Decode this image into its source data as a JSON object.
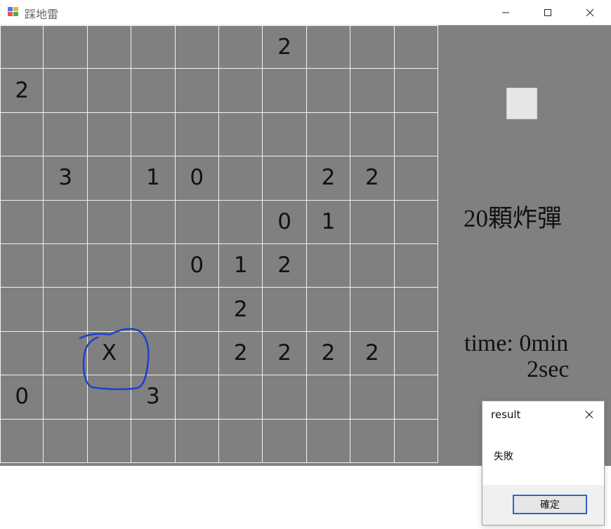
{
  "window": {
    "title": "踩地雷",
    "app_icon": "window-app-icon",
    "controls": {
      "minimize_icon": "minimize-icon",
      "maximize_icon": "maximize-icon",
      "close_icon": "close-icon"
    }
  },
  "board": {
    "rows": [
      [
        "",
        "",
        "",
        "",
        "",
        "",
        "2",
        "",
        "",
        ""
      ],
      [
        "2",
        "",
        "",
        "",
        "",
        "",
        "",
        "",
        "",
        ""
      ],
      [
        "",
        "",
        "",
        "",
        "",
        "",
        "",
        "",
        "",
        ""
      ],
      [
        "",
        "3",
        "",
        "1",
        "0",
        "",
        "",
        "2",
        "2",
        ""
      ],
      [
        "",
        "",
        "",
        "",
        "",
        "",
        "0",
        "1",
        "",
        ""
      ],
      [
        "",
        "",
        "",
        "",
        "0",
        "1",
        "2",
        "",
        "",
        ""
      ],
      [
        "",
        "",
        "",
        "",
        "",
        "2",
        "",
        "",
        "",
        ""
      ],
      [
        "",
        "",
        "X",
        "",
        "",
        "2",
        "2",
        "2",
        "2",
        ""
      ],
      [
        "0",
        "",
        "",
        "3",
        "",
        "",
        "",
        "",
        "",
        ""
      ],
      [
        "",
        "",
        "",
        "",
        "",
        "",
        "",
        "",
        "",
        ""
      ]
    ],
    "annotation_color": "#1f3fd1"
  },
  "side_panel": {
    "restart_icon": "restart-square-icon",
    "bomb_count_text": "20顆炸彈",
    "time_line_1": "time: 0min",
    "time_line_2": "2sec"
  },
  "dialog": {
    "title": "result",
    "message": "失敗",
    "ok_label": "確定",
    "close_icon": "dialog-close-icon"
  },
  "colors": {
    "board_background": "#808080",
    "grid_line": "#f2f2f2",
    "dialog_accent": "#2f63c8"
  }
}
